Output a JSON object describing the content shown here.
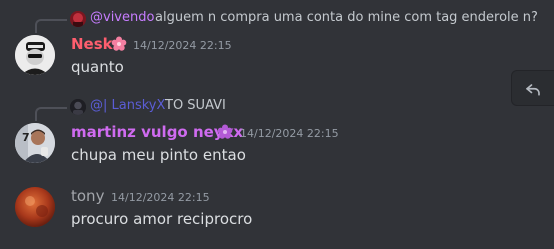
{
  "colors": {
    "background": "#313338",
    "nesk_name": "#ff5e6e",
    "martinz_name": "#cf6bf0",
    "tony_name": "#a3a6ab",
    "reply_vivendo_name": "#c77dff",
    "reply_lanskyx_name": "#5b5dd6",
    "badge_pink": "#f47fa1",
    "badge_purple": "#b35ad6"
  },
  "icons": {
    "reply_action": "reply-arrow-icon",
    "nesk_badge": "flower-badge-icon",
    "martinz_badge": "flower-badge-icon"
  },
  "messages": [
    {
      "reply": {
        "name": "@vivendo",
        "text": "alguem n compra uma conta do mine com tag enderole n?"
      },
      "author": "Nesk",
      "timestamp": "14/12/2024 22:15",
      "content": "quanto"
    },
    {
      "reply": {
        "name": "@| LanskyX",
        "text": "TO SUAVI"
      },
      "author": "martinz vulgo neykx",
      "timestamp": "14/12/2024 22:15",
      "content": "chupa meu pinto entao"
    },
    {
      "author": "tony",
      "timestamp": "14/12/2024 22:15",
      "content": "procuro amor reciprocro"
    }
  ]
}
